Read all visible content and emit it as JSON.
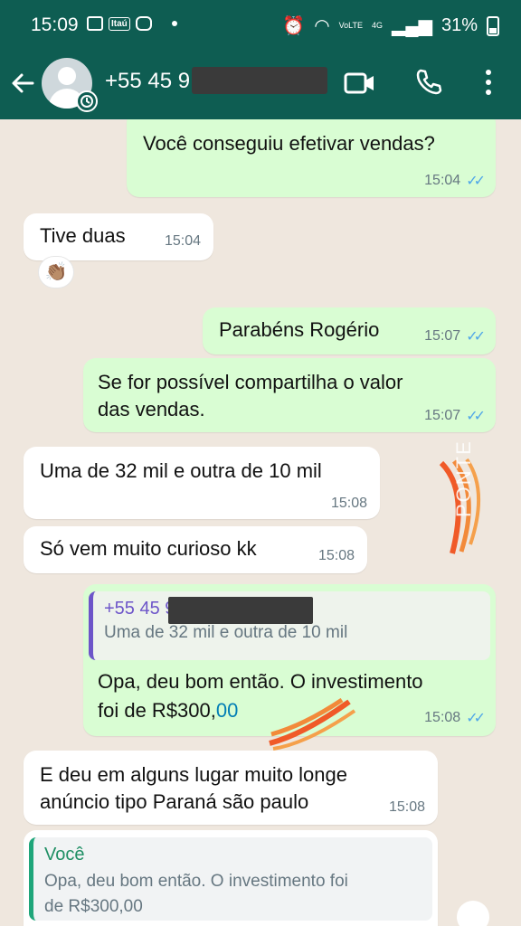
{
  "status_bar": {
    "time": "15:09",
    "itau": "Itaú",
    "volte": "VoLTE",
    "network": "4G",
    "battery": "31%"
  },
  "header": {
    "contact_name": "+55 45 9"
  },
  "messages": {
    "m1": {
      "text": "Você conseguiu efetivar vendas?",
      "time": "15:04"
    },
    "m2": {
      "text": "Tive duas",
      "time": "15:04",
      "reaction": "👏🏽"
    },
    "m3": {
      "text": "Parabéns Rogério",
      "time": "15:07"
    },
    "m4": {
      "line1": "Se for possível compartilha o valor",
      "line2": "das vendas.",
      "time": "15:07"
    },
    "m5": {
      "text": "Uma de 32 mil e outra de 10 mil",
      "time": "15:08"
    },
    "m6": {
      "text": "Só vem muito curioso kk",
      "time": "15:08"
    },
    "m7": {
      "quote_author": "+55 45 9",
      "quote_text": "Uma de 32 mil e outra de 10 mil",
      "line1": "Opa, deu bom então. O investimento",
      "line2": "foi de R$300,",
      "line2_cents": "00",
      "time": "15:08"
    },
    "m8": {
      "line1": "E deu em alguns lugar muito longe",
      "line2": "anúncio tipo Paraná são paulo",
      "time": "15:08"
    },
    "m9": {
      "quote_author": "Você",
      "quote_line1": "Opa, deu bom então. O investimento foi",
      "quote_line2": "de R$300,00"
    }
  },
  "watermark": {
    "text": "PONTE"
  },
  "colors": {
    "header": "#0e5d52",
    "outgoing": "#d9fdd3",
    "incoming": "#ffffff",
    "read_ticks": "#4fa6e8",
    "chat_bg": "#efe7de"
  }
}
